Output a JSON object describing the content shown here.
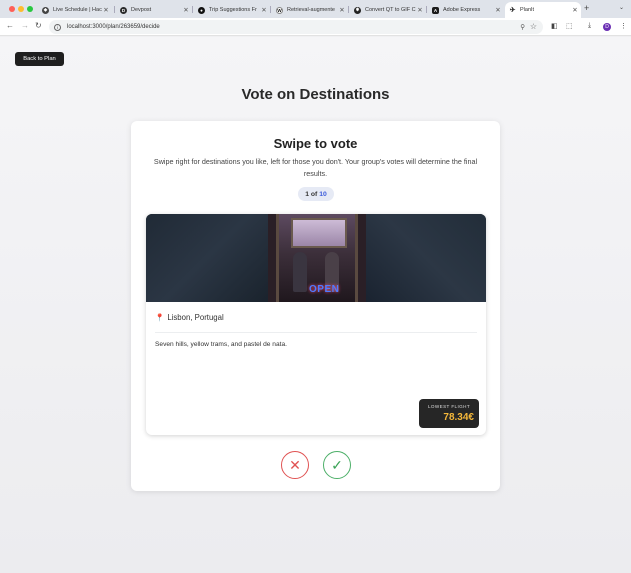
{
  "browser": {
    "tabs": [
      {
        "title": "Live Schedule | Hac",
        "icon": "schedule-icon",
        "active": false
      },
      {
        "title": "Devpost",
        "icon": "devpost-icon",
        "active": false
      },
      {
        "title": "Trip Suggestions Fr",
        "icon": "github-icon",
        "active": false
      },
      {
        "title": "Retrieval-augmente",
        "icon": "wikipedia-icon",
        "active": false
      },
      {
        "title": "Convert QT to GIF C",
        "icon": "convert-icon",
        "active": false
      },
      {
        "title": "Adobe Express",
        "icon": "adobe-icon",
        "active": false
      },
      {
        "title": "PlanIt",
        "icon": "plane-icon",
        "active": true
      }
    ],
    "url": "localhost:3000/plan/263659/decide",
    "profile_initial": "D"
  },
  "page": {
    "back_label": "Back to Plan",
    "title": "Vote on Destinations",
    "card_title": "Swipe to vote",
    "card_subtitle": "Swipe right for destinations you like, left for those you don't. Your group's votes will determine the final results.",
    "counter": {
      "current": "1",
      "of": "of",
      "total": "10"
    },
    "destination": {
      "location": "Lisbon, Portugal",
      "description": "Seven hills, yellow trams, and pastel de nata.",
      "photo_sign": "OPEN",
      "flight_label": "LOWEST FLIGHT",
      "flight_price": "78.34€"
    },
    "buttons": {
      "reject": "✕",
      "accept": "✓"
    }
  },
  "colors": {
    "accent_blue": "#3b5bdb",
    "reject_red": "#e05252",
    "accept_green": "#4caf68",
    "price_gold": "#f5b83a",
    "dark_button": "#1f1f1f"
  }
}
